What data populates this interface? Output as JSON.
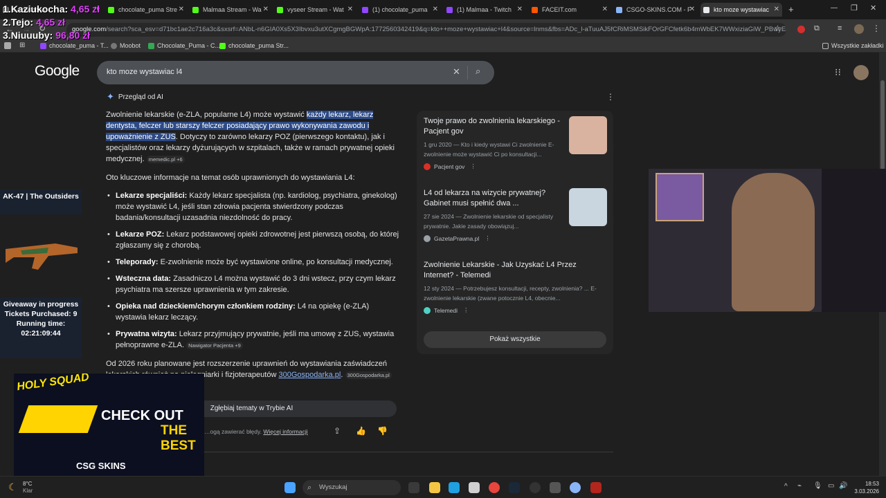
{
  "tabs": [
    {
      "label": "Kaziukocha",
      "color": "#6e6e6e"
    },
    {
      "label": "chocolate_puma Stre",
      "color": "#53fc18"
    },
    {
      "label": "Malmaa Stream - Wa",
      "color": "#53fc18"
    },
    {
      "label": "vyseer Stream - Wat",
      "color": "#53fc18"
    },
    {
      "label": "(1) chocolate_puma",
      "color": "#9146ff"
    },
    {
      "label": "(1) Malmaa - Twitch",
      "color": "#9146ff"
    },
    {
      "label": "FACEIT.com",
      "color": "#ff5500"
    },
    {
      "label": "CSGO-SKINS.COM - F",
      "color": "#8ab4f8"
    },
    {
      "label": "kto moze wystawiac",
      "color": "#e8eaed"
    }
  ],
  "url": {
    "domain": "google.com",
    "path": "/search?sca_esv=d71bc1ae2c716a3c&sxsrf=ANbL-n6GIA0Xs5X3Ibvxu3utXCgmgBGWpA:1772560342419&q=kto++moze+wystawiac+l4&source=lnms&fbs=ADc_l-aTuuAJ5fCRiMSMSikFOrGFCfetk6b4mWbEK7WWxiziaGiW_PBwyEhe..."
  },
  "bookmarks": [
    {
      "label": "chocolate_puma - T...",
      "color": "#9146ff"
    },
    {
      "label": "Moobot",
      "color": "#888"
    },
    {
      "label": "Chocolate_Puma - C...",
      "color": "#34a853"
    },
    {
      "label": "chocolate_puma Str...",
      "color": "#53fc18"
    },
    {
      "label": "Wszystkie zakładki",
      "color": "#bbb"
    }
  ],
  "overlay_leaderboard": [
    {
      "rank": "1.",
      "name": "Kaziukocha:",
      "amount": "4,65 zł"
    },
    {
      "rank": "2.",
      "name": "Tejo:",
      "amount": "4,65 zł"
    },
    {
      "rank": "3.",
      "name": "Niuuuby:",
      "amount": "96,80 zł"
    }
  ],
  "google": {
    "logo": "Google",
    "query": "kto moze wystawiac l4",
    "ai_overview_label": "Przegląd od AI",
    "intro_plain": "Zwolnienie lekarskie (e-ZLA, popularne L4) może wystawić",
    "intro_highlight": "każdy lekarz, lekarz dentysta, felczer lub starszy felczer posiadający prawo wykonywania zawodu i upoważnienie z ZUS",
    "intro_rest": ". Dotyczy to zarówno lekarzy POZ (pierwszego kontaktu), jak i specjalistów oraz lekarzy dyżurujących w szpitalach, także w ramach prywatnej opieki medycznej.",
    "intro_chip": "memedic.pl +6",
    "list_intro": "Oto kluczowe informacje na temat osób uprawnionych do wystawiania L4:",
    "bullets": [
      {
        "term": "Lekarze specjaliści:",
        "text": " Każdy lekarz specjalista (np. kardiolog, psychiatra, ginekolog) może wystawić L4, jeśli stan zdrowia pacjenta stwierdzony podczas badania/konsultacji uzasadnia niezdolność do pracy."
      },
      {
        "term": "Lekarze POZ:",
        "text": " Lekarz podstawowej opieki zdrowotnej jest pierwszą osobą, do której zgłaszamy się z chorobą."
      },
      {
        "term": "Teleporady:",
        "text": " E-zwolnienie może być wystawione online, po konsultacji medycznej."
      },
      {
        "term": "Wsteczna data:",
        "text": " Zasadniczo L4 można wystawić do 3 dni wstecz, przy czym lekarz psychiatra ma szersze uprawnienia w tym zakresie."
      },
      {
        "term": "Opieka nad dzieckiem/chorym członkiem rodziny:",
        "text": " L4 na opiekę (e-ZLA) wystawia lekarz leczący."
      },
      {
        "term": "Prywatna wizyta:",
        "text": " Lekarz przyjmujący prywatnie, jeśli ma umowę z ZUS, wystawia pełnoprawne e-ZLA."
      }
    ],
    "bullet_chip": "Nawigator Pacjenta +9",
    "outro": "Od 2026 roku planowane jest rozszerzenie uprawnień do wystawiania zaświadczeń lekarskich również na pielęgniarki i fizjoterapeutów",
    "outro_link": "300Gospodarka.pl",
    "outro_chip": "300Gospodarka.pl",
    "deep_dive": "Zgłębiaj tematy w Trybie AI",
    "disclaimer": "…ogą zawierać błędy.",
    "more_info": "Więcej informacji",
    "sources": [
      {
        "title": "Twoje prawo do zwolnienia lekarskiego - Pacjent gov",
        "snippet": "1 gru 2020 — Kto i kiedy wystawi Ci zwolnienie E-zwolnienie może wystawić Ci po konsultacji...",
        "site": "Pacjent gov"
      },
      {
        "title": "L4 od lekarza na wizycie prywatnej? Gabinet musi spełnić dwa ...",
        "snippet": "27 sie 2024 — Zwolnienie lekarskie od specjalisty prywatnie. Jakie zasady obowiązuj...",
        "site": "GazetaPrawna.pl"
      },
      {
        "title": "Zwolnienie Lekarskie - Jak Uzyskać L4 Przez Internet? - Telemedi",
        "snippet": "12 sty 2024 — Potrzebujesz konsultacji, recepty, zwolnienia? ... E-zwolnienie lekarskie (zwane potocznie L4, obecnie...",
        "site": "Telemedi"
      }
    ],
    "show_all": "Pokaż wszystkie"
  },
  "stream_widgets": {
    "skin_name": "AK-47 | The Outsiders",
    "giveaway": "Giveaway in progress",
    "tickets": "Tickets Purchased: 9",
    "running": "Running time: 02:21:09:44",
    "promo_top": "HOLY SQUAD",
    "promo_main": "CHECK OUT",
    "promo_sub": "THE BEST",
    "promo_brand": "CSG SKINS"
  },
  "taskbar": {
    "weather_temp": "8°C",
    "weather_desc": "Klar",
    "search": "Wyszukaj",
    "time": "18:53",
    "date": "3.03.2026"
  }
}
